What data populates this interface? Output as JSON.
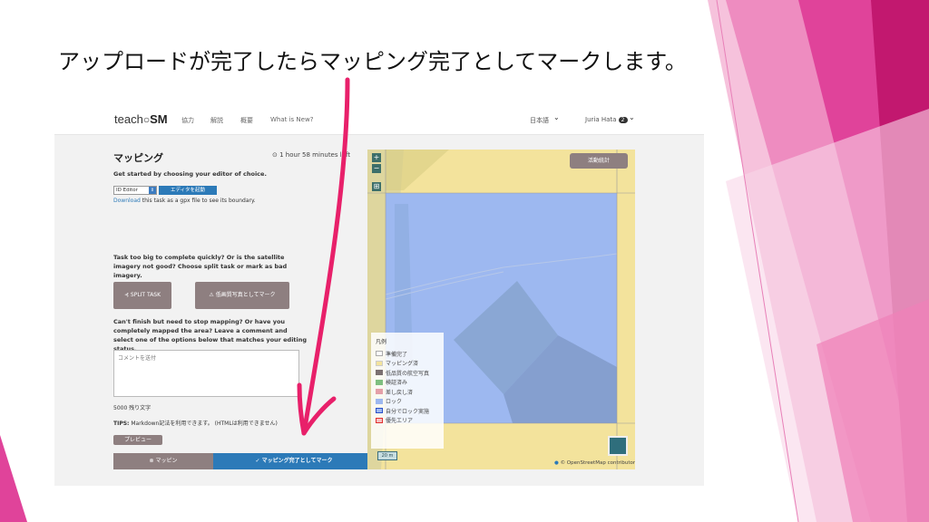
{
  "slide": {
    "title": "アップロードが完了したらマッピング完了としてマークします。"
  },
  "app": {
    "logo_prefix": "teach",
    "logo_suffix": "SM",
    "nav": [
      "協力",
      "解説",
      "概要",
      "What is New?"
    ],
    "language": "日本語",
    "user": "Juria Hata",
    "user_badge": "2"
  },
  "panel": {
    "title": "マッピング",
    "timer": "1 hour 58 minutes left",
    "editor_prompt": "Get started by choosing your editor of choice.",
    "editor_select": "ID Editor",
    "launch_editor": "エディタを起動",
    "download_link": "Download",
    "download_rest": " this task as a gpx file to see its boundary.",
    "split_prompt": "Task too big to complete quickly? Or is the satellite imagery not good? Choose split task or mark as bad imagery.",
    "split_button": "SPLIT TASK",
    "bad_imagery_button": "低画質写真としてマーク",
    "stop_prompt": "Can't finish but need to stop mapping? Or have you completely mapped the area? Leave a comment and select one of the options below that matches your editing status.",
    "comment_placeholder": "コメントを送付",
    "char_count": "5000 残り文字",
    "tips_label": "TIPS:",
    "tips_text": " Markdown記法を利用できます。 (HTMLは利用できません)",
    "preview_button": "プレビュー",
    "stop_button": "マッピン",
    "complete_button": "マッピング完了としてマーク"
  },
  "map": {
    "stats_button": "活動統計",
    "zoom_in": "+",
    "zoom_out": "−",
    "legend_title": "凡例",
    "legend": [
      {
        "label": "準備完了",
        "color": "#ffffff",
        "border": "#aaaaaa"
      },
      {
        "label": "マッピング済",
        "color": "#f3e39c",
        "border": "#cccccc"
      },
      {
        "label": "低品質の航空写真",
        "color": "#7b7070",
        "border": "#7b7070"
      },
      {
        "label": "検証済み",
        "color": "#7fbf7f",
        "border": "#7fbf7f"
      },
      {
        "label": "差し戻し済",
        "color": "#e4a0a8",
        "border": "#e4a0a8"
      },
      {
        "label": "ロック",
        "color": "#9db8f0",
        "border": "#9db8f0"
      },
      {
        "label": "自分でロック実施",
        "color": "#9db8f0",
        "border": "#2a50c8"
      },
      {
        "label": "優先エリア",
        "color": "#f4c0c0",
        "border": "#e03030"
      }
    ],
    "scale": "20 m",
    "attribution_prefix": "© OpenStreetMap",
    "attribution_suffix": " contributors"
  },
  "colors": {
    "accent_blue": "#2c7ab8",
    "button_gray": "#8e7f80",
    "annotation_pink": "#e8206a",
    "deco_magenta": "#c2186f"
  }
}
